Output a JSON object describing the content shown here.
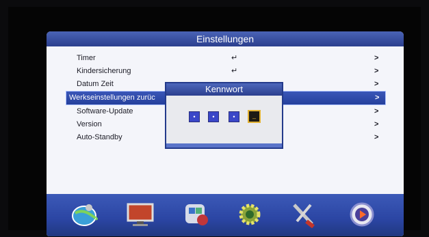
{
  "header": {
    "title": "Einstellungen"
  },
  "menu": {
    "items": [
      {
        "label": "Timer",
        "enter": "↵",
        "chevron": ">"
      },
      {
        "label": "Kindersicherung",
        "enter": "↵",
        "chevron": ">"
      },
      {
        "label": "Datum Zeit",
        "chevron": ">"
      },
      {
        "label": "Werkseinstellungen zurüc",
        "chevron": ">",
        "selected": true
      },
      {
        "label": "Software-Update",
        "chevron": ">"
      },
      {
        "label": "Version",
        "chevron": ">"
      },
      {
        "label": "Auto-Standby",
        "chevron": ">"
      }
    ]
  },
  "dialog": {
    "title": "Kennwort",
    "pin_digits": [
      "•",
      "•",
      "•",
      "_"
    ]
  },
  "iconbar": {
    "icons": [
      "satellite-globe-icon",
      "tv-monitor-icon",
      "settings-puzzle-icon",
      "gear-icon",
      "tools-icon",
      "media-play-icon"
    ]
  },
  "colors": {
    "accent": "#2b3f8e",
    "highlight": "#e2b233"
  }
}
